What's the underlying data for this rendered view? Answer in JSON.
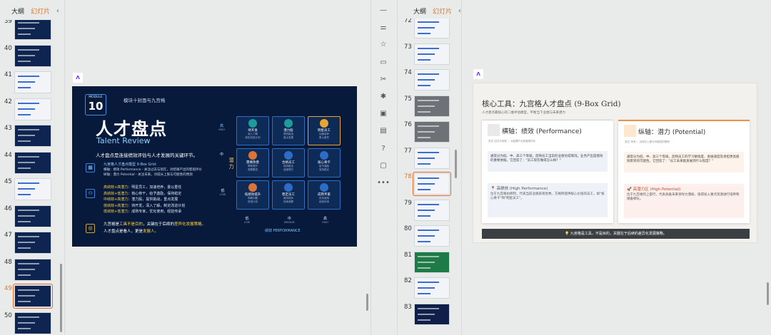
{
  "left_panel": {
    "tabs": [
      "大纲",
      "幻灯片"
    ],
    "active_tab": "幻灯片",
    "thumbs": [
      {
        "num": "39",
        "theme": "dark"
      },
      {
        "num": "40",
        "theme": "dark"
      },
      {
        "num": "41",
        "theme": "light"
      },
      {
        "num": "42",
        "theme": "light"
      },
      {
        "num": "43",
        "theme": "dark"
      },
      {
        "num": "44",
        "theme": "dark"
      },
      {
        "num": "45",
        "theme": "light"
      },
      {
        "num": "46",
        "theme": "dark"
      },
      {
        "num": "47",
        "theme": "dark"
      },
      {
        "num": "48",
        "theme": "dark"
      },
      {
        "num": "49",
        "theme": "dark",
        "selected": true
      },
      {
        "num": "50",
        "theme": "dark"
      }
    ]
  },
  "right_panel": {
    "tabs": [
      "大纲",
      "幻灯片"
    ],
    "active_tab": "幻灯片",
    "thumbs": [
      {
        "num": "72",
        "theme": "light"
      },
      {
        "num": "73",
        "theme": "light"
      },
      {
        "num": "74",
        "theme": "light"
      },
      {
        "num": "75",
        "theme": "gray"
      },
      {
        "num": "76",
        "theme": "gray"
      },
      {
        "num": "77",
        "theme": "light"
      },
      {
        "num": "78",
        "theme": "light",
        "selected": true
      },
      {
        "num": "79",
        "theme": "light"
      },
      {
        "num": "80",
        "theme": "light"
      },
      {
        "num": "81",
        "theme": "green"
      },
      {
        "num": "82",
        "theme": "light"
      },
      {
        "num": "83",
        "theme": "navy"
      }
    ]
  },
  "toolbar_icons": [
    "minus-icon",
    "sliders-icon",
    "star-icon",
    "chat-icon",
    "tools-icon",
    "bug-icon",
    "image-icon",
    "book-icon",
    "help-icon",
    "comment-icon",
    "more-icon"
  ],
  "slide1": {
    "module_label": "MODULE",
    "module_num": "10",
    "kicker": "模块十封面与九宫格",
    "title": "人才盘点",
    "subtitle": "Talent Review",
    "lead": "人才盘点是连接绩效评估与人才发展的关键环节。",
    "model_title": "九宫格人才盘点模型 9-Box Grid:",
    "model_desc1": "横轴：绩效 Performance - 关注过去与现在，对结果产出的客观评价",
    "model_desc2": "纵轴：潜力 Potential - 关注未来，对成长上限与可能性的预测",
    "list": [
      {
        "k": "高绩效+高潜力",
        "v": "：明星员工，加速培养，委以重任"
      },
      {
        "k": "高绩效+低潜力",
        "v": "：核心骨干，给予激励，保持稳定"
      },
      {
        "k": "中绩效+高潜力",
        "v": "：潜力股，提供挑战，重点发展"
      },
      {
        "k": "低绩效+高潜力",
        "v": "：待开发，深入了解，制定改进计划"
      },
      {
        "k": "低绩效+低潜力",
        "v": "：成熟专家，优化使用，经验传承"
      }
    ],
    "footer1_a": "九宫格是",
    "footer1_b": "工具不是目的",
    "footer1_c": "，关键在于后续的",
    "footer1_d": "差异化发展策略。",
    "footer2_a": "人才盘点是看人，更是",
    "footer2_b": "发展人。",
    "axis_y_high": "高",
    "axis_y_high_en": "HIGH",
    "axis_y_mid": "中",
    "axis_y_label": "潜力",
    "axis_y_low": "低",
    "axis_y_low_en": "LOW",
    "axis_x": [
      "低",
      "中",
      "高"
    ],
    "axis_x_en": [
      "LOW",
      "MEDIUM",
      "HIGH"
    ],
    "axis_x_label": "绩效 PERFORMANCE",
    "cells": [
      {
        "name": "待开发",
        "d1": "深入了解",
        "d2": "制定改进计划",
        "color": "#1c9d9a"
      },
      {
        "name": "潜力股",
        "d1": "提供挑战",
        "d2": "重点发展",
        "color": "#1c9d9a"
      },
      {
        "name": "明星员工",
        "d1": "加速培养",
        "d2": "委以重任",
        "color": "#e8a531"
      },
      {
        "name": "需要改善",
        "d1": "帮助提升",
        "d2": "观察跟进",
        "color": "#d8743a"
      },
      {
        "name": "合格员工",
        "d1": "保持稳定",
        "d2": "适度提升",
        "color": "#2e6cc4"
      },
      {
        "name": "核心骨干",
        "d1": "给予激励",
        "d2": "保持稳定",
        "color": "#2e6cc4"
      },
      {
        "name": "低绩效提升",
        "d1": "明确问题",
        "d2": "改进计划",
        "color": "#d8743a"
      },
      {
        "name": "稳定员工",
        "d1": "维持现状",
        "d2": "持续观察",
        "color": "#2e6cc4"
      },
      {
        "name": "成熟专家",
        "d1": "优化使用",
        "d2": "经验传承",
        "color": "#2e6cc4"
      }
    ]
  },
  "slide2": {
    "title": "核心工具：九宫格人才盘点 (9-Box Grid)",
    "subtitle": "人才盘点最核心的二维评估模型，平衡当下业绩与未来潜力",
    "card1": {
      "title": "横轴：绩效 (Performance)",
      "sub": "关注\"过去与现在\"，对结果产出的客观评价",
      "body": "通常分为低、中、高三个等级，反映员工当前的业绩达成情况。业务产出是绩效的重要依据。它回答了：\"员工现在做得怎么样？\"",
      "box_title": "高绩效 (High Performance)",
      "box_body": "位于九宫格右侧列，代表当前业绩表现优秀。方格所提供核心价值的员工，如\"核心骨干\"和\"明星员工\"。"
    },
    "card2": {
      "title": "纵轴：潜力 (Potential)",
      "sub": "关注\"未来\"，对成长上限与可能性的预测",
      "body": "通常分为低、中、高三个等级，反映员工的学习敏锐度、发展速度及承担更高级别职责的可能性。它回答了：\"员工未来能发展到什么程度？\"",
      "box_title": "高潜力区 (High Potential)",
      "box_body": "位于九宫格的上部行，代表具备未来领导力潜质，值得投入重点资源进行培养和储备梯队。"
    },
    "bar": "九宫格是工具，不是目的，关键在于后续的差异化发展策略。"
  },
  "colors": {
    "accent": "#e0782b",
    "slide1_bg": "#081a3c",
    "highlight": "#ffd44a"
  }
}
